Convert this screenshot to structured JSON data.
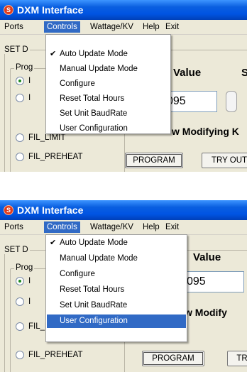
{
  "app": {
    "title": "DXM Interface",
    "icon_label": "S"
  },
  "menubar": {
    "items": [
      "Ports",
      "Controls",
      "Wattage/KV",
      "Help",
      "Exit"
    ]
  },
  "controls_menu": {
    "items": [
      {
        "label": "Auto Update Mode",
        "checked": true
      },
      {
        "label": "Manual Update Mode",
        "checked": false
      },
      {
        "label": "Configure",
        "checked": false
      },
      {
        "label": "Reset Total Hours",
        "checked": false
      },
      {
        "label": "Set Unit BaudRate",
        "checked": false
      },
      {
        "label": "User Configuration",
        "checked": false
      }
    ],
    "check_mark": "✔",
    "highlighted_in_second_view": "User Configuration"
  },
  "panel1": {
    "group_label": "SET D",
    "subgroup_label": "Prog",
    "radio_labels": [
      "I",
      "I",
      "FIL_LIMIT",
      "FIL_PREHEAT"
    ],
    "radio_label_partial": "FIL_LIMIT",
    "value_label": "Value",
    "side_label": "S",
    "value": "095",
    "modifying_text": "w Modifying K",
    "program_button": "PROGRAM",
    "tryout_button": "TRY OUT"
  },
  "panel2": {
    "group_label": "SET D",
    "subgroup_label": "Prog",
    "value_label": "Value",
    "value": "095",
    "modifying_text": "w Modify",
    "radio_last_label": "FIL_PREHEAT",
    "program_button": "PROGRAM",
    "tryout_button": "TR"
  },
  "colors": {
    "title_bar": "#0054e3",
    "menu_highlight": "#316ac5",
    "window_bg": "#ece9d8"
  }
}
